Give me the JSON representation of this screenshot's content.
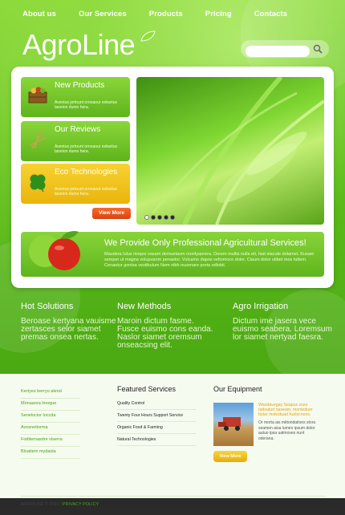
{
  "nav": [
    "About us",
    "Our Services",
    "Products",
    "Pricing",
    "Contacts"
  ],
  "logo": "AgroLine",
  "search": {
    "placeholder": ""
  },
  "features": [
    {
      "title": "New Products",
      "text": "Aventus jortount ornoaour eokartus taoeion dumo hera.",
      "icon": "crate-icon"
    },
    {
      "title": "Our Reviews",
      "text": "Aventus jortount ornoaour eokartus taoeion dumo hera.",
      "icon": "grain-icon"
    },
    {
      "title": "Eco Technologies",
      "text": "Aventus jortount ornoaour eokartus taoeion dumo hera.",
      "icon": "clover-icon"
    }
  ],
  "view_more": "View More",
  "slider": {
    "dots": 5,
    "active": 0
  },
  "banner": {
    "title": "We Provide Only Professional Agricultural Services!",
    "text": "Maudera lulus nioqoo vasam demuelaum montyaorera. Dorem multis nulla eit, hiat elacute dolamet. Kusam semper ut magna volupuanm penaelor. Vulcamo dapos veltomoce dolor. Ciaum dolor utibet mos tultem. Cenaotur gontsa vestibulum Nem nibh nusenare porta odlobit."
  },
  "columns": [
    {
      "title": "Hot Solutions",
      "text": "Beroase kertyana vauisme zertasces selor siamet premas onsea nertas."
    },
    {
      "title": "New Methods",
      "text": "Maroin dictum fasme. Fusce euismo cons eanda. Naslor siamet oremsum onseacsing elit."
    },
    {
      "title": "Agro Irrigation",
      "text": "Dictum ime jasera vece euismo seabera. Loremsum lor siamet nertyad faesra."
    }
  ],
  "links": [
    "Kertyes berryo alend",
    "Monaaora lmoque",
    "Senelocior loccda",
    "Avosnetiorma",
    "Foditemasdre viserra",
    "Bloatiem mydaola"
  ],
  "featured_services": {
    "title": "Featured Services",
    "items": [
      "Quality Control",
      "Twenty Four Hours Support Service",
      "Organic Food & Farming",
      "Natural Technologies"
    ]
  },
  "equipment": {
    "title": "Our Equipment",
    "highlight": "Waodavegay Seapus zuso tadoatud naseam, monteduer bolar molestuad Karlycnons.",
    "text": "Or morta ais mittondaitons stora seamen aisa lumeo ipsum dolor autuo ipsa uatmoses nunt oderana.",
    "button": "View More"
  },
  "footer": {
    "brand": "AGROLINE",
    "year": "© 2011",
    "sep": "|",
    "privacy": "PRIVACY POLICY"
  },
  "colors": {
    "primary_green": "#5fbf1c",
    "orange": "#e8541a",
    "yellow": "#eab40b"
  }
}
